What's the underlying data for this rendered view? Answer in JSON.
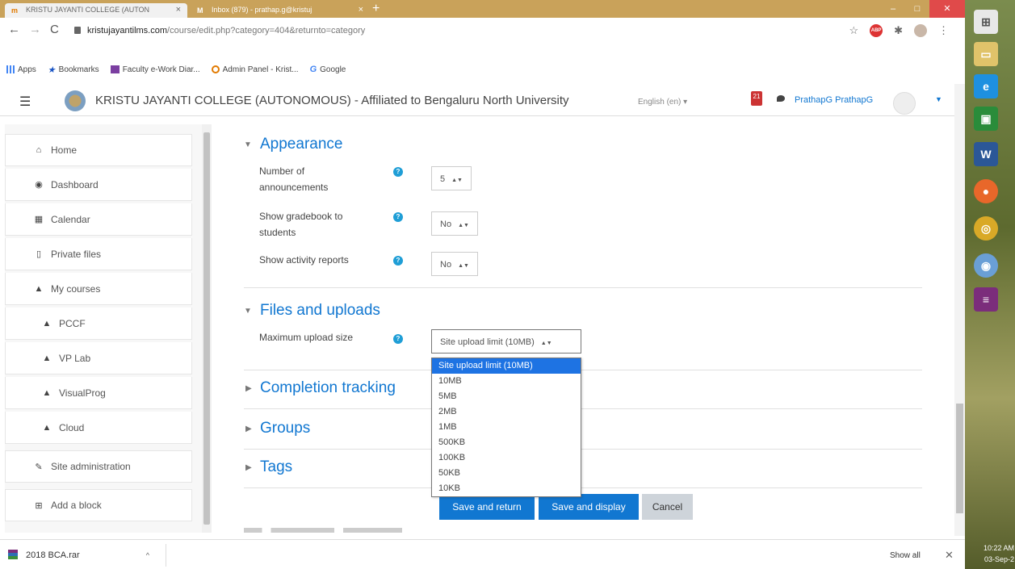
{
  "browser": {
    "tabs": [
      {
        "label": "KRISTU JAYANTI COLLEGE (AUTON",
        "icon": "moodle-favicon"
      },
      {
        "label": "Inbox (879) - prathap.g@kristuj",
        "icon": "gmail-favicon"
      }
    ],
    "url_host": "kristujayantilms.com",
    "url_path": "/course/edit.php?category=404&returnto=category",
    "bookmarks": [
      "Apps",
      "Bookmarks",
      "Faculty e-Work Diar...",
      "Admin Panel - Krist...",
      "Google"
    ]
  },
  "header": {
    "site_name": "KRISTU JAYANTI COLLEGE (AUTONOMOUS) - Affiliated to Bengaluru North University",
    "language": "English (en) ▾",
    "notification_count": "21",
    "username": "PrathapG PrathapG"
  },
  "sidebar": {
    "items": [
      {
        "label": "Home",
        "icon": "home-icon"
      },
      {
        "label": "Dashboard",
        "icon": "dashboard-icon"
      },
      {
        "label": "Calendar",
        "icon": "calendar-icon"
      },
      {
        "label": "Private files",
        "icon": "file-icon"
      },
      {
        "label": "My courses",
        "icon": "graduation-cap-icon"
      },
      {
        "label": "PCCF",
        "icon": "graduation-cap-icon"
      },
      {
        "label": "VP Lab",
        "icon": "graduation-cap-icon"
      },
      {
        "label": "VisualProg",
        "icon": "graduation-cap-icon"
      },
      {
        "label": "Cloud",
        "icon": "graduation-cap-icon"
      },
      {
        "label": "Site administration",
        "icon": "wrench-icon"
      },
      {
        "label": "Add a block",
        "icon": "plus-square-icon"
      }
    ]
  },
  "form": {
    "appearance": {
      "title": "Appearance",
      "announcements_label_1": "Number of",
      "announcements_label_2": "announcements",
      "announcements_value": "5",
      "gradebook_label_1": "Show gradebook to",
      "gradebook_label_2": "students",
      "gradebook_value": "No",
      "activity_label": "Show activity reports",
      "activity_value": "No"
    },
    "files": {
      "title": "Files and uploads",
      "max_upload_label": "Maximum upload size",
      "max_upload_value": "Site upload limit (10MB)",
      "options": [
        "Site upload limit (10MB)",
        "10MB",
        "5MB",
        "2MB",
        "1MB",
        "500KB",
        "100KB",
        "50KB",
        "10KB"
      ]
    },
    "collapsed_sections": [
      "Completion tracking",
      "Groups",
      "Tags"
    ],
    "buttons": {
      "save_return": "Save and return",
      "save_display": "Save and display",
      "cancel": "Cancel"
    }
  },
  "downloads": {
    "file": "2018 BCA.rar",
    "show_all": "Show all"
  },
  "taskbar": {
    "time": "10:22 AM",
    "date": "03-Sep-2"
  }
}
